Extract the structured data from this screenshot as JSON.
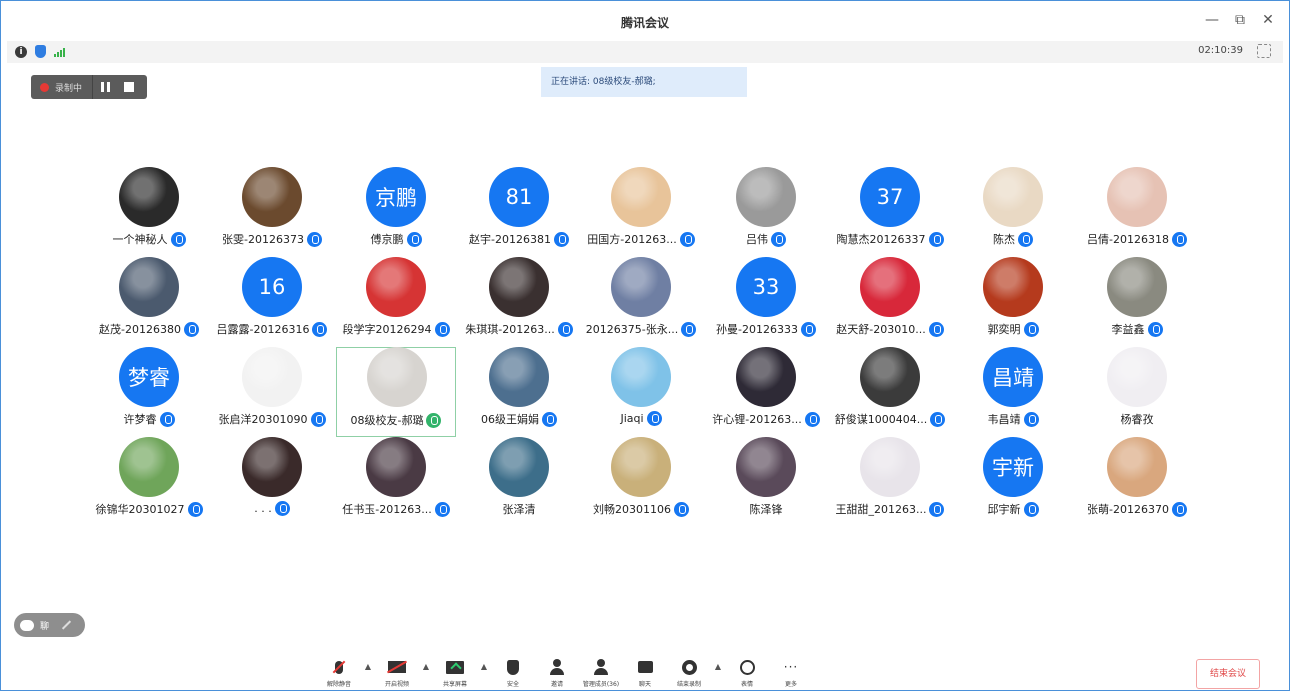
{
  "window": {
    "title": "腾讯会议",
    "minimize": "—",
    "restore": "⧉",
    "close": "✕"
  },
  "infobar": {
    "timer": "02:10:39"
  },
  "recording": {
    "label": "录制中"
  },
  "speaking": {
    "text": "正在讲话: 08级校友-郝璐;"
  },
  "participants": [
    {
      "name": "一个神秘人",
      "avatar": "img",
      "color": "#2a2a2a"
    },
    {
      "name": "张雯-20126373",
      "avatar": "img",
      "color": "#6b4a2e"
    },
    {
      "name": "傅京鹏",
      "avatar": "text",
      "text": "京鹏"
    },
    {
      "name": "赵宇-20126381",
      "avatar": "text",
      "text": "81"
    },
    {
      "name": "田国方-201263...",
      "avatar": "img",
      "color": "#e8c49a"
    },
    {
      "name": "吕伟",
      "avatar": "img",
      "color": "#9a9a9a"
    },
    {
      "name": "陶慧杰20126337",
      "avatar": "text",
      "text": "37"
    },
    {
      "name": "陈杰",
      "avatar": "img",
      "color": "#e9d9c4"
    },
    {
      "name": "吕倩-20126318",
      "avatar": "img",
      "color": "#e6c2b4"
    },
    {
      "name": "赵茂-20126380",
      "avatar": "img",
      "color": "#4b5a6e"
    },
    {
      "name": "吕露露-20126316",
      "avatar": "text",
      "text": "16"
    },
    {
      "name": "段学字20126294",
      "avatar": "img",
      "color": "#d63434"
    },
    {
      "name": "朱琪琪-201263...",
      "avatar": "img",
      "color": "#3a3030"
    },
    {
      "name": "20126375-张永...",
      "avatar": "img",
      "color": "#6f7fa3"
    },
    {
      "name": "孙曼-20126333",
      "avatar": "text",
      "text": "33"
    },
    {
      "name": "赵天舒-203010...",
      "avatar": "img",
      "color": "#d8283a"
    },
    {
      "name": "郭奕明",
      "avatar": "img",
      "color": "#b53a1d"
    },
    {
      "name": "李益鑫",
      "avatar": "img",
      "color": "#8a8a80"
    },
    {
      "name": "许梦睿",
      "avatar": "text",
      "text": "梦睿"
    },
    {
      "name": "张启洋20301090",
      "avatar": "img",
      "color": "#f2f2f2"
    },
    {
      "name": "08级校友-郝璐",
      "avatar": "img",
      "color": "#d7d4d0",
      "active": true
    },
    {
      "name": "06级王娟娟",
      "avatar": "img",
      "color": "#4d6f8f"
    },
    {
      "name": "Jiaqi",
      "avatar": "img",
      "color": "#7fc2e8"
    },
    {
      "name": "许心锂-201263...",
      "avatar": "img",
      "color": "#2e2a36"
    },
    {
      "name": "舒俊谋1000404...",
      "avatar": "img",
      "color": "#3b3b3b"
    },
    {
      "name": "韦昌靖",
      "avatar": "text",
      "text": "昌靖"
    },
    {
      "name": "杨睿孜",
      "avatar": "img",
      "color": "#f0eef2"
    },
    {
      "name": "徐锦华20301027",
      "avatar": "img",
      "color": "#6fa55a"
    },
    {
      "name": ". . .",
      "avatar": "img",
      "color": "#3a2a2a"
    },
    {
      "name": "任书玉-201263...",
      "avatar": "img",
      "color": "#4a3a44"
    },
    {
      "name": "张泽清",
      "avatar": "img",
      "color": "#3d6e8a"
    },
    {
      "name": "刘畅20301106",
      "avatar": "img",
      "color": "#c9b07a"
    },
    {
      "name": "陈泽锋",
      "avatar": "img",
      "color": "#5a4a5a"
    },
    {
      "name": "王甜甜_201263...",
      "avatar": "img",
      "color": "#e8e4ea"
    },
    {
      "name": "邱宇新",
      "avatar": "text",
      "text": "宇新"
    },
    {
      "name": "张萌-20126370",
      "avatar": "img",
      "color": "#d9a77e"
    }
  ],
  "chat": {
    "label": "聊"
  },
  "toolbar": {
    "items": [
      {
        "name": "unmute",
        "label": "解除静音",
        "icon": "mic-muted-icon"
      },
      {
        "name": "start-video",
        "label": "开启视频",
        "icon": "camera-off-icon"
      },
      {
        "name": "share-screen",
        "label": "共享屏幕",
        "icon": "share-screen-icon"
      },
      {
        "name": "security",
        "label": "安全",
        "icon": "shield-icon"
      },
      {
        "name": "invite",
        "label": "邀请",
        "icon": "invite-icon"
      },
      {
        "name": "manage-members",
        "label": "管理成员(36)",
        "icon": "members-icon"
      },
      {
        "name": "chat",
        "label": "聊天",
        "icon": "chat-icon"
      },
      {
        "name": "end-recording",
        "label": "结束录制",
        "icon": "record-icon"
      },
      {
        "name": "reaction",
        "label": "表情",
        "icon": "emoji-icon"
      },
      {
        "name": "more",
        "label": "更多",
        "icon": "more-icon"
      }
    ],
    "end_meeting": "结束会议"
  },
  "colors": {
    "accent": "#1677f2",
    "record": "#e53935",
    "end": "#e04848",
    "active_border": "#8fd0a6"
  }
}
